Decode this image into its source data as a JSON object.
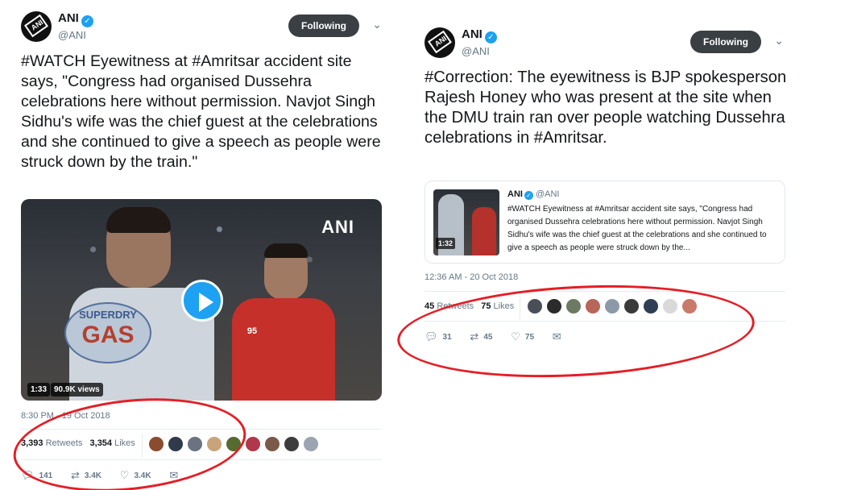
{
  "left_tweet": {
    "author_name": "ANI",
    "author_handle": "@ANI",
    "avatar_text": "ANI",
    "verified_glyph": "✓",
    "follow_label": "Following",
    "text": "#WATCH Eyewitness at #Amritsar accident site says, \"Congress had organised Dussehra celebrations here without permission. Navjot Singh Sidhu's wife was the chief guest at the celebrations and she continued to give a speech as people were struck down by the train.\"",
    "video": {
      "overlay_brand": "ANI",
      "duration": "1:33",
      "views": "90.9K views",
      "shirt_brand": "SUPERDRY",
      "shirt_text": "GAS",
      "shirt_number": "95"
    },
    "timestamp": "8:30 PM - 19 Oct 2018",
    "retweets_count": "3,393",
    "retweets_label": "Retweets",
    "likes_count": "3,354",
    "likes_label": "Likes",
    "liker_colors": [
      "#8a4b2e",
      "#2f3a4a",
      "#6b7280",
      "#c8a47a",
      "#556b2f",
      "#b0384a",
      "#7a5a48",
      "#3d3d3d",
      "#9aa5b1"
    ],
    "actions": {
      "reply_count": "141",
      "retweet_count": "3.4K",
      "like_count": "3.4K"
    }
  },
  "right_tweet": {
    "author_name": "ANI",
    "author_handle": "@ANI",
    "avatar_text": "ANI",
    "verified_glyph": "✓",
    "follow_label": "Following",
    "text": "#Correction: The eyewitness is BJP spokesperson Rajesh Honey who was present at the site when the DMU train ran over people watching Dussehra celebrations in #Amritsar.",
    "quoted": {
      "name": "ANI",
      "handle": "@ANI",
      "duration": "1:32",
      "text": "#WATCH Eyewitness at #Amritsar accident site says, \"Congress had organised Dussehra celebrations here without permission. Navjot Singh Sidhu's wife was the chief guest at the celebrations and she continued to give a speech as people were struck down by the..."
    },
    "timestamp": "12:36 AM - 20 Oct 2018",
    "retweets_count": "45",
    "retweets_label": "Retweets",
    "likes_count": "75",
    "likes_label": "Likes",
    "liker_colors": [
      "#4a4f57",
      "#2b2b2b",
      "#6d7a63",
      "#b8665a",
      "#8c9aa8",
      "#3a3a3a",
      "#2f3e55",
      "#d9d9d9",
      "#c97a6a"
    ],
    "actions": {
      "reply_count": "31",
      "retweet_count": "45",
      "like_count": "75"
    }
  },
  "icons": {
    "reply": "reply-icon",
    "retweet": "retweet-icon",
    "like": "heart-icon",
    "message": "message-icon"
  },
  "annotation_color": "#e41e26"
}
